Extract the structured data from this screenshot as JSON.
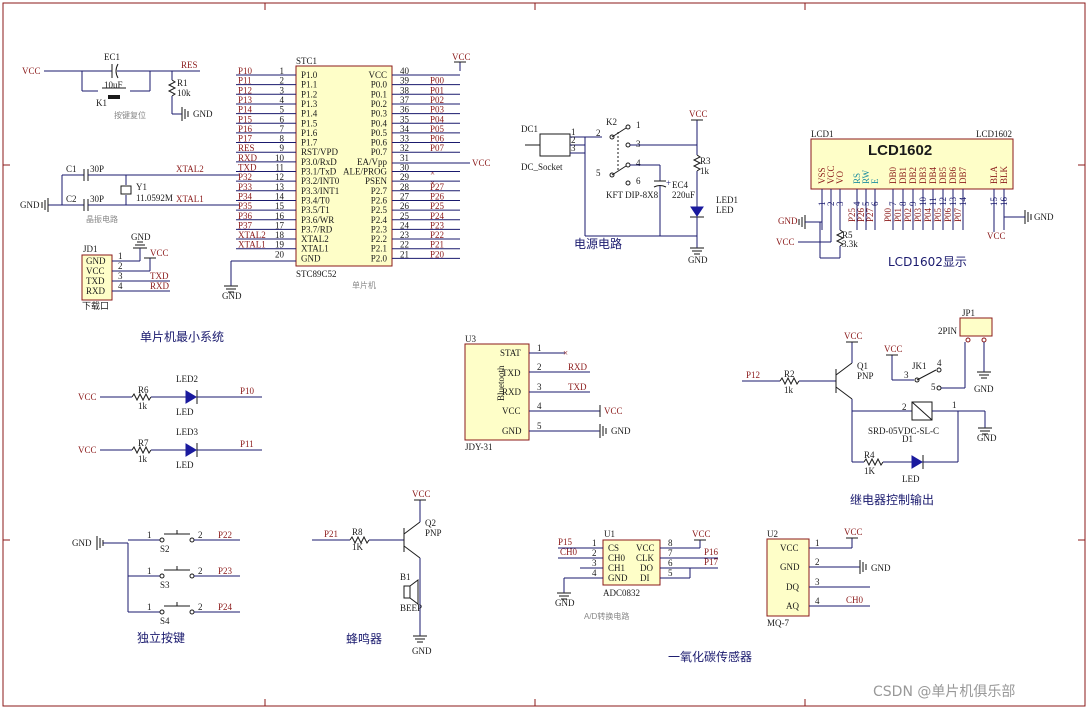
{
  "sections": {
    "mcu_min_system": "单片机最小系统",
    "power": "电源电路",
    "lcd": "LCD1602显示",
    "relay": "继电器控制输出",
    "keys": "独立按键",
    "buzzer": "蜂鸣器",
    "co_sensor": "一氧化碳传感器",
    "ad_conv": "A/D转换电路",
    "reset_note": "按键复位",
    "osc_note": "晶振电路",
    "mcu_note": "单片机"
  },
  "watermark": "CSDN @单片机俱乐部",
  "mcu": {
    "ref": "STC1",
    "part": "STC89C52",
    "left_pins": [
      {
        "num": "1",
        "name": "P1.0",
        "net": "P10"
      },
      {
        "num": "2",
        "name": "P1.1",
        "net": "P11"
      },
      {
        "num": "3",
        "name": "P1.2",
        "net": "P12"
      },
      {
        "num": "4",
        "name": "P1.3",
        "net": "P13"
      },
      {
        "num": "5",
        "name": "P1.4",
        "net": "P14"
      },
      {
        "num": "6",
        "name": "P1.5",
        "net": "P15"
      },
      {
        "num": "7",
        "name": "P1.6",
        "net": "P16"
      },
      {
        "num": "8",
        "name": "P1.7",
        "net": "P17"
      },
      {
        "num": "9",
        "name": "RST/VPD",
        "net": "RES"
      },
      {
        "num": "10",
        "name": "P3.0/RxD",
        "net": "RXD"
      },
      {
        "num": "11",
        "name": "P3.1/TxD",
        "net": "TXD"
      },
      {
        "num": "12",
        "name": "P3.2/INT0",
        "net": "P32"
      },
      {
        "num": "13",
        "name": "P3.3/INT1",
        "net": "P33"
      },
      {
        "num": "14",
        "name": "P3.4/T0",
        "net": "P34"
      },
      {
        "num": "15",
        "name": "P3.5/T1",
        "net": "P35"
      },
      {
        "num": "16",
        "name": "P3.6/WR",
        "net": "P36"
      },
      {
        "num": "17",
        "name": "P3.7/RD",
        "net": "P37"
      },
      {
        "num": "18",
        "name": "XTAL2",
        "net": "XTAL2"
      },
      {
        "num": "19",
        "name": "XTAL1",
        "net": "XTAL1"
      },
      {
        "num": "20",
        "name": "GND",
        "net": ""
      }
    ],
    "right_pins": [
      {
        "num": "40",
        "name": "VCC",
        "net": ""
      },
      {
        "num": "39",
        "name": "P0.0",
        "net": "P00"
      },
      {
        "num": "38",
        "name": "P0.1",
        "net": "P01"
      },
      {
        "num": "37",
        "name": "P0.2",
        "net": "P02"
      },
      {
        "num": "36",
        "name": "P0.3",
        "net": "P03"
      },
      {
        "num": "35",
        "name": "P0.4",
        "net": "P04"
      },
      {
        "num": "34",
        "name": "P0.5",
        "net": "P05"
      },
      {
        "num": "33",
        "name": "P0.6",
        "net": "P06"
      },
      {
        "num": "32",
        "name": "P0.7",
        "net": "P07"
      },
      {
        "num": "31",
        "name": "EA/Vpp",
        "net": "VCC"
      },
      {
        "num": "30",
        "name": "ALE/PROG",
        "net": ""
      },
      {
        "num": "29",
        "name": "PSEN",
        "net": ""
      },
      {
        "num": "28",
        "name": "P2.7",
        "net": "P27"
      },
      {
        "num": "27",
        "name": "P2.6",
        "net": "P26"
      },
      {
        "num": "26",
        "name": "P2.5",
        "net": "P25"
      },
      {
        "num": "25",
        "name": "P2.4",
        "net": "P24"
      },
      {
        "num": "24",
        "name": "P2.3",
        "net": "P23"
      },
      {
        "num": "23",
        "name": "P2.2",
        "net": "P22"
      },
      {
        "num": "22",
        "name": "P2.1",
        "net": "P21"
      },
      {
        "num": "21",
        "name": "P2.0",
        "net": "P20"
      }
    ]
  },
  "lcd": {
    "ref": "LCD1",
    "ref2": "LCD1602",
    "title": "LCD1602",
    "pins": [
      {
        "num": "1",
        "name": "VSS",
        "color": "red"
      },
      {
        "num": "2",
        "name": "VCC",
        "color": "red"
      },
      {
        "num": "3",
        "name": "VO",
        "color": "red"
      },
      {
        "num": "4",
        "name": "RS",
        "color": "cyan"
      },
      {
        "num": "5",
        "name": "RW",
        "color": "cyan"
      },
      {
        "num": "6",
        "name": "E",
        "color": "cyan"
      },
      {
        "num": "7",
        "name": "DB0",
        "color": "red"
      },
      {
        "num": "8",
        "name": "DB1",
        "color": "red"
      },
      {
        "num": "9",
        "name": "DB2",
        "color": "red"
      },
      {
        "num": "10",
        "name": "DB3",
        "color": "red"
      },
      {
        "num": "11",
        "name": "DB4",
        "color": "red"
      },
      {
        "num": "12",
        "name": "DB5",
        "color": "red"
      },
      {
        "num": "13",
        "name": "DB6",
        "color": "red"
      },
      {
        "num": "14",
        "name": "DB7",
        "color": "red"
      },
      {
        "num": "15",
        "name": "BLA",
        "color": "red"
      },
      {
        "num": "16",
        "name": "BLK",
        "color": "red"
      }
    ],
    "nets": [
      "P25",
      "P26",
      "P27",
      "P00",
      "P01",
      "P02",
      "P03",
      "P04",
      "P05",
      "P06",
      "P07"
    ],
    "r5": "R5",
    "r5_val": "3.3k"
  },
  "labels": {
    "vcc": "VCC",
    "gnd": "GND",
    "res": "RES",
    "ec1": "EC1",
    "ec1_val": "10uF",
    "r1": "R1",
    "r1_val": "10k",
    "k1": "K1",
    "c1": "C1",
    "c2": "C2",
    "c_val": "30P",
    "y1": "Y1",
    "y1_val": "11.0592M",
    "xtal1": "XTAL1",
    "xtal2": "XTAL2",
    "jd1": "JD1",
    "jd1_note": "下载口",
    "jd_pins": [
      "GND",
      "VCC",
      "TXD",
      "RXD"
    ],
    "txd": "TXD",
    "rxd": "RXD",
    "dc1": "DC1",
    "dc_socket": "DC_Socket",
    "k2": "K2",
    "k2_part": "KFT DIP-8X8",
    "ec4": "EC4",
    "ec4_val": "220uF",
    "r3": "R3",
    "r3_val": "1k",
    "led1": "LED1",
    "led": "LED",
    "u3": "U3",
    "u3_part": "JDY-31",
    "bluetooth": "Bluetooth",
    "u3_pins": [
      "STAT",
      "TXD",
      "RXD",
      "VCC",
      "GND"
    ],
    "r6": "R6",
    "r7": "R7",
    "r_1k": "1k",
    "r_1K": "1K",
    "led2": "LED2",
    "led3": "LED3",
    "p10": "P10",
    "p11": "P11",
    "p12": "P12",
    "p15": "P15",
    "p16": "P16",
    "p17": "P17",
    "p21": "P21",
    "p22": "P22",
    "p23": "P23",
    "p24": "P24",
    "s2": "S2",
    "s3": "S3",
    "s4": "S4",
    "r8": "R8",
    "q2": "Q2",
    "pnp": "PNP",
    "b1": "B1",
    "beep": "BEEP",
    "u1": "U1",
    "u1_part": "ADC0832",
    "u1_left": [
      "CS",
      "CH0",
      "CH1",
      "GND"
    ],
    "u1_right": [
      "VCC",
      "CLK",
      "DO",
      "DI"
    ],
    "ch0": "CH0",
    "u2": "U2",
    "u2_part": "MQ-7",
    "u2_pins": [
      "VCC",
      "GND",
      "DQ",
      "AQ"
    ],
    "r2": "R2",
    "q1": "Q1",
    "jk1": "JK1",
    "jk1_part": "SRD-05VDC-SL-C",
    "d1": "D1",
    "r4": "R4",
    "jp1": "JP1",
    "jp1_part": "2PIN"
  }
}
